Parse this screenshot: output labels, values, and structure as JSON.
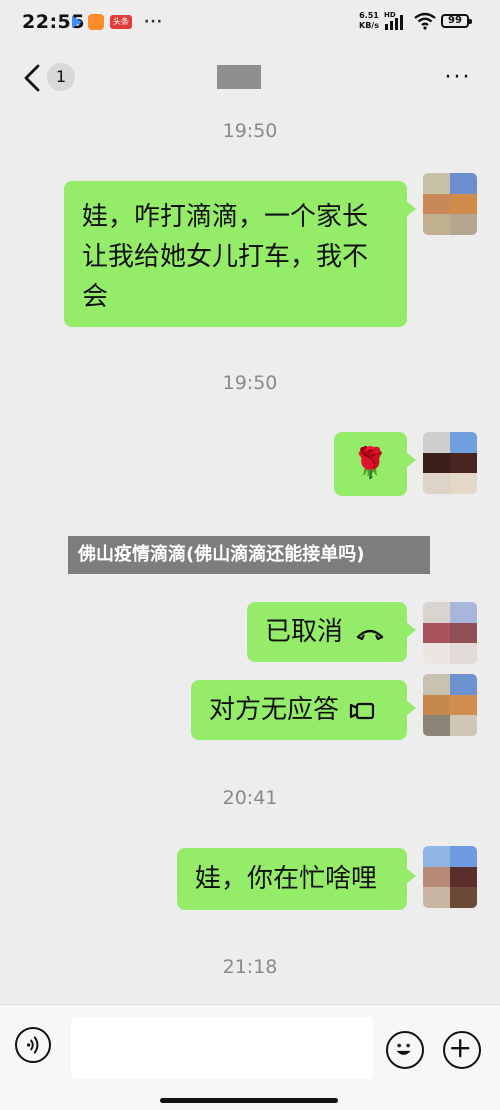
{
  "status_bar": {
    "time": "22:55",
    "notif_badge_text": "头条",
    "more_dots": "···",
    "net_speed_value": "6.51",
    "net_speed_unit": "KB/s",
    "signal_label": "HD",
    "battery": "99"
  },
  "header": {
    "back_icon": "chevron-left-icon",
    "unread_count": "1",
    "contact_name": "",
    "more_label": "···"
  },
  "messages": [
    {
      "time": "19:50",
      "type": "text",
      "text_lines": [
        "娃，咋打滴滴，一个家长",
        "让我给她女儿打车，我不",
        "会"
      ]
    },
    {
      "time": "19:50",
      "type": "sticker",
      "emoji": "🌹"
    },
    {
      "type": "call",
      "text": "已取消",
      "icon": "phone-hangup-icon"
    },
    {
      "type": "call",
      "text": "对方无应答",
      "icon": "video-camera-icon"
    },
    {
      "time": "20:41",
      "type": "text",
      "text_lines": [
        "娃，你在忙啥哩"
      ]
    },
    {
      "time": "21:18"
    }
  ],
  "overlay_caption": "佛山疫情滴滴(佛山滴滴还能接单吗)",
  "input_bar": {
    "placeholder": "",
    "voice_icon": "voice-icon",
    "emoji_icon": "emoji-icon",
    "plus_icon": "plus-icon"
  },
  "colors": {
    "bubble": "#95ec69",
    "background": "#ededed"
  }
}
